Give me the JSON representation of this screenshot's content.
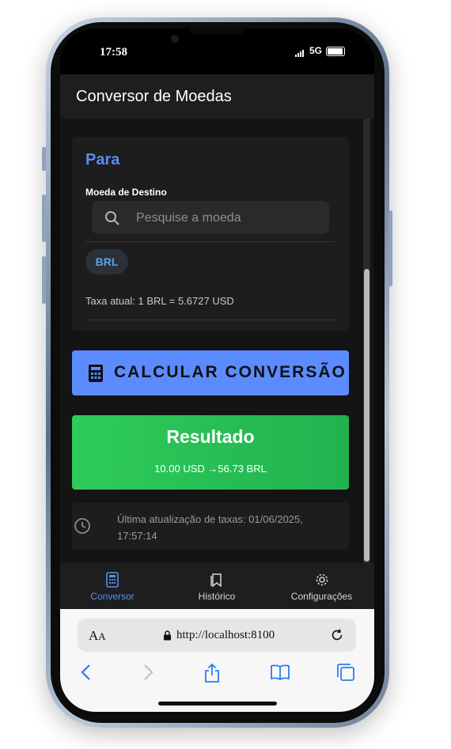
{
  "status_bar": {
    "time": "17:58",
    "network": "5G"
  },
  "app": {
    "title": "Conversor de Moedas"
  },
  "to_section": {
    "heading": "Para",
    "currency_label": "Moeda de Destino",
    "search_placeholder": "Pesquise a moeda",
    "selected_currency": "BRL",
    "rate_text": "Taxa atual: 1 BRL = 5.6727 USD"
  },
  "calculate_button": {
    "label": "CALCULAR CONVERSÃO"
  },
  "result": {
    "heading": "Resultado",
    "from_text": "10.00 USD",
    "arrow": "→",
    "to_text": "56.73 BRL"
  },
  "update_info": {
    "text": "Última atualização de taxas: 01/06/2025, 17:57:14"
  },
  "tabs": [
    {
      "label": "Conversor",
      "icon": "calculator-icon",
      "active": true
    },
    {
      "label": "Histórico",
      "icon": "bookmarks-icon",
      "active": false
    },
    {
      "label": "Configurações",
      "icon": "gear-icon",
      "active": false
    }
  ],
  "browser": {
    "aa_label": "AA",
    "url": "http://localhost:8100"
  },
  "colors": {
    "accent_blue": "#5b8bff",
    "result_green": "#2ecc5a",
    "heading_blue": "#5b8df0",
    "background": "#141414"
  }
}
